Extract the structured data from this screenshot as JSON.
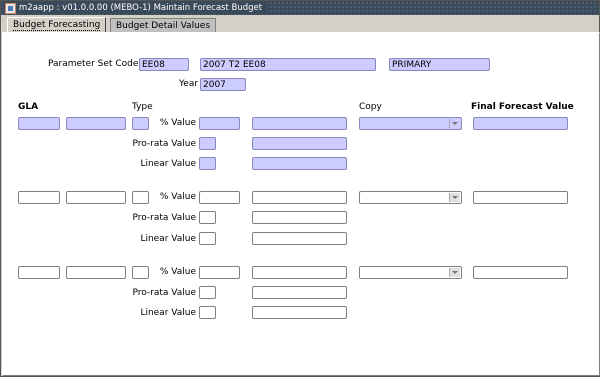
{
  "window": {
    "title": "m2aapp : v01.0.0.00 (MEBO-1) Maintain Forecast Budget"
  },
  "tabs": [
    {
      "label": "Budget Forecasting"
    },
    {
      "label": "Budget Detail Values"
    }
  ],
  "parameter": {
    "set_code_label": "Parameter Set Code",
    "set_code": "EE08",
    "description": "2007 T2 EE08",
    "type": "PRIMARY",
    "year_label": "Year",
    "year": "2007"
  },
  "headers": {
    "gla": "GLA",
    "type": "Type",
    "copy": "Copy",
    "final": "Final Forecast Value"
  },
  "row_labels": {
    "percent": "% Value",
    "prorata": "Pro-rata Value",
    "linear": "Linear Value"
  }
}
